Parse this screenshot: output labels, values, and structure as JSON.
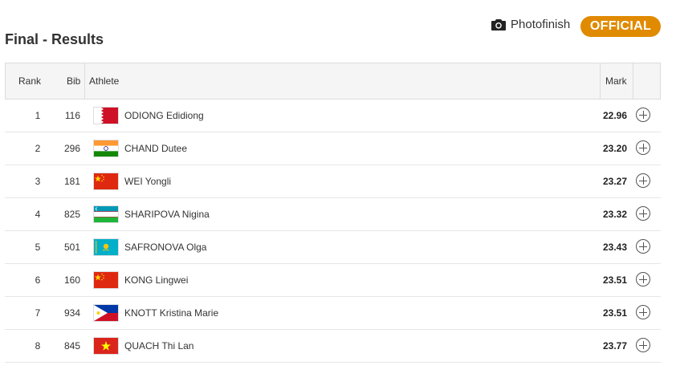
{
  "header": {
    "title": "Final - Results",
    "photofinish_label": "Photofinish",
    "status_badge": "OFFICIAL"
  },
  "colors": {
    "badge": "#e08a00"
  },
  "table": {
    "columns": {
      "rank": "Rank",
      "bib": "Bib",
      "athlete": "Athlete",
      "mark": "Mark"
    },
    "rows": [
      {
        "rank": "1",
        "bib": "116",
        "flag": "bahrain-flag-icon",
        "athlete": "ODIONG Edidiong",
        "mark": "22.96"
      },
      {
        "rank": "2",
        "bib": "296",
        "flag": "india-flag-icon",
        "athlete": "CHAND Dutee",
        "mark": "23.20"
      },
      {
        "rank": "3",
        "bib": "181",
        "flag": "china-flag-icon",
        "athlete": "WEI Yongli",
        "mark": "23.27"
      },
      {
        "rank": "4",
        "bib": "825",
        "flag": "uzbekistan-flag-icon",
        "athlete": "SHARIPOVA Nigina",
        "mark": "23.32"
      },
      {
        "rank": "5",
        "bib": "501",
        "flag": "kazakhstan-flag-icon",
        "athlete": "SAFRONOVA Olga",
        "mark": "23.43"
      },
      {
        "rank": "6",
        "bib": "160",
        "flag": "china-flag-icon",
        "athlete": "KONG Lingwei",
        "mark": "23.51"
      },
      {
        "rank": "7",
        "bib": "934",
        "flag": "philippines-flag-icon",
        "athlete": "KNOTT Kristina Marie",
        "mark": "23.51"
      },
      {
        "rank": "8",
        "bib": "845",
        "flag": "vietnam-flag-icon",
        "athlete": "QUACH Thi Lan",
        "mark": "23.77"
      }
    ]
  }
}
